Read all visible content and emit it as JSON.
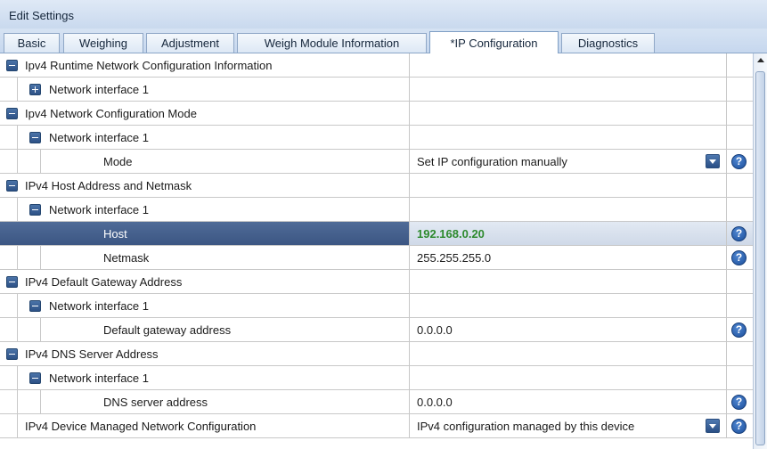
{
  "window": {
    "title": "Edit Settings"
  },
  "tabs": [
    {
      "label": "Basic"
    },
    {
      "label": "Weighing"
    },
    {
      "label": "Adjustment"
    },
    {
      "label": "Weigh Module Information"
    },
    {
      "label": "*IP Configuration",
      "active": true
    },
    {
      "label": "Diagnostics"
    }
  ],
  "grid": {
    "rows": [
      {
        "label": "Ipv4 Runtime Network Configuration Information",
        "value": ""
      },
      {
        "label": "Network interface 1",
        "value": ""
      },
      {
        "label": "Ipv4 Network Configuration Mode",
        "value": ""
      },
      {
        "label": "Network interface 1",
        "value": ""
      },
      {
        "label": "Mode",
        "value": "Set IP configuration manually"
      },
      {
        "label": "IPv4 Host Address and Netmask",
        "value": ""
      },
      {
        "label": "Network interface 1",
        "value": ""
      },
      {
        "label": "Host",
        "value": "192.168.0.20",
        "selected": true,
        "modified": true
      },
      {
        "label": "Netmask",
        "value": "255.255.255.0"
      },
      {
        "label": "IPv4 Default Gateway Address",
        "value": ""
      },
      {
        "label": "Network interface 1",
        "value": ""
      },
      {
        "label": "Default gateway address",
        "value": "0.0.0.0"
      },
      {
        "label": "IPv4 DNS Server Address",
        "value": ""
      },
      {
        "label": "Network interface 1",
        "value": ""
      },
      {
        "label": "DNS server address",
        "value": "0.0.0.0"
      },
      {
        "label": "IPv4 Device Managed Network Configuration",
        "value": "IPv4 configuration managed by this device"
      }
    ]
  },
  "help_glyph": "?",
  "colors": {
    "selected_row": "#3c5683",
    "modified_value": "#2d8a2d",
    "accent": "#2a4f85"
  }
}
